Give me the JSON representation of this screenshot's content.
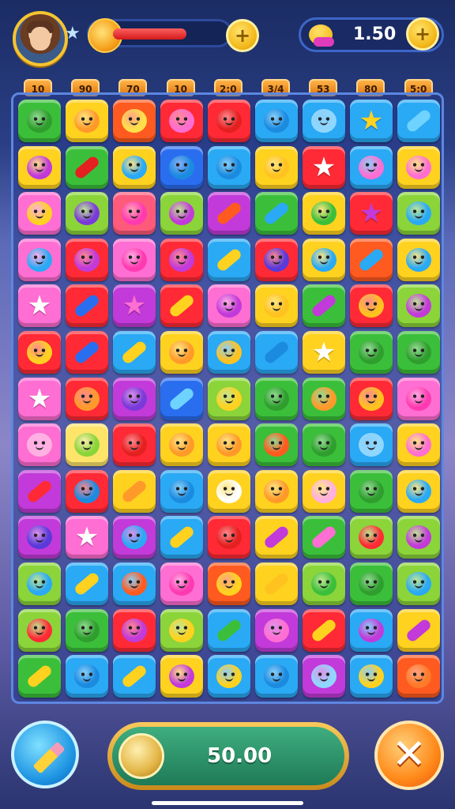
{
  "hud": {
    "energy_fill": 0.62,
    "coins_value": "1.50",
    "plus_label": "+"
  },
  "column_labels": [
    "10",
    "90",
    "70",
    "10",
    "2:0",
    "3/4",
    "53",
    "80",
    "5:0"
  ],
  "board": {
    "rows": [
      [
        [
          "#3bbf3a",
          "blob",
          "#2f9e2e"
        ],
        [
          "#ffd21f",
          "blob",
          "#ff9a2a"
        ],
        [
          "#ff5a1f",
          "blob",
          "#ffe04a"
        ],
        [
          "#ff2a35",
          "blob",
          "#ff6ed2"
        ],
        [
          "#ff2a35",
          "blob",
          "#e52020"
        ],
        [
          "#2aa9f5",
          "blob",
          "#1b8be0"
        ],
        [
          "#2aa9f5",
          "blob",
          "#8fd7ff"
        ],
        [
          "#2aa9f5",
          "star",
          "#ffd21f"
        ],
        [
          "#2aa9f5",
          "candy",
          "#6fd3ff"
        ]
      ],
      [
        [
          "#ffd21f",
          "blob",
          "#c23ad9"
        ],
        [
          "#3bbf3a",
          "candy",
          "#e52020"
        ],
        [
          "#ffd21f",
          "blob",
          "#2aa9f5"
        ],
        [
          "#2a6ef0",
          "blob",
          "#1b8be0"
        ],
        [
          "#2aa9f5",
          "blob",
          "#1b8be0"
        ],
        [
          "#ffd21f",
          "blob",
          "#ffc21f"
        ],
        [
          "#ff2a35",
          "star",
          "#ffffff"
        ],
        [
          "#2aa9f5",
          "blob",
          "#ff6ed2"
        ],
        [
          "#ffd21f",
          "blob",
          "#ff6ed2"
        ]
      ],
      [
        [
          "#ff6ed2",
          "blob",
          "#ffd21f"
        ],
        [
          "#8bd43a",
          "blob",
          "#7a3ad9"
        ],
        [
          "#ff5a7a",
          "blob",
          "#ff3ab0"
        ],
        [
          "#8bd43a",
          "blob",
          "#c23ad9"
        ],
        [
          "#c23ad9",
          "candy",
          "#ff5a1f"
        ],
        [
          "#3bbf3a",
          "candy",
          "#2aa9f5"
        ],
        [
          "#ffd21f",
          "blob",
          "#3bbf3a"
        ],
        [
          "#ff2a35",
          "star",
          "#c23ad9"
        ],
        [
          "#8bd43a",
          "blob",
          "#2aa9f5"
        ]
      ],
      [
        [
          "#ff6ed2",
          "blob",
          "#2aa9f5"
        ],
        [
          "#ff2a35",
          "blob",
          "#c23ad9"
        ],
        [
          "#ff6ed2",
          "blob",
          "#ff3ab0"
        ],
        [
          "#ff2a35",
          "blob",
          "#c23ad9"
        ],
        [
          "#2aa9f5",
          "candy",
          "#ffd21f"
        ],
        [
          "#ff2a35",
          "blob",
          "#5a3ad9"
        ],
        [
          "#ffd21f",
          "blob",
          "#2aa9f5"
        ],
        [
          "#ff5a1f",
          "candy",
          "#2aa9f5"
        ],
        [
          "#ffd21f",
          "blob",
          "#2aa9f5"
        ]
      ],
      [
        [
          "#ff6ed2",
          "star",
          "#ffffff"
        ],
        [
          "#ff2a35",
          "candy",
          "#2a6ef0"
        ],
        [
          "#c23ad9",
          "star",
          "#ff6ed2"
        ],
        [
          "#ff2a35",
          "candy",
          "#ffd21f"
        ],
        [
          "#ff6ed2",
          "blob",
          "#c23ad9"
        ],
        [
          "#ffd21f",
          "blob",
          "#ffc21f"
        ],
        [
          "#3bbf3a",
          "candy",
          "#c23ad9"
        ],
        [
          "#ff2a35",
          "blob",
          "#ffc21f"
        ],
        [
          "#8bd43a",
          "blob",
          "#c23ad9"
        ]
      ],
      [
        [
          "#ff2a35",
          "blob",
          "#ffd21f"
        ],
        [
          "#ff2a35",
          "candy",
          "#2a6ef0"
        ],
        [
          "#2aa9f5",
          "candy",
          "#ffd21f"
        ],
        [
          "#ffd21f",
          "blob",
          "#ff9a2a"
        ],
        [
          "#2aa9f5",
          "blob",
          "#ffc21f"
        ],
        [
          "#2aa9f5",
          "candy",
          "#1b8be0"
        ],
        [
          "#ffd21f",
          "star",
          "#ffffff"
        ],
        [
          "#3bbf3a",
          "blob",
          "#2f9e2e"
        ],
        [
          "#3bbf3a",
          "blob",
          "#2f9e2e"
        ]
      ],
      [
        [
          "#ff6ed2",
          "star",
          "#ffffff"
        ],
        [
          "#ff2a35",
          "blob",
          "#ff9a2a"
        ],
        [
          "#c23ad9",
          "blob",
          "#7a3ad9"
        ],
        [
          "#2a6ef0",
          "candy",
          "#6fd3ff"
        ],
        [
          "#8bd43a",
          "blob",
          "#ffd21f"
        ],
        [
          "#3bbf3a",
          "blob",
          "#2f9e2e"
        ],
        [
          "#3bbf3a",
          "blob",
          "#ff9a2a"
        ],
        [
          "#ff2a35",
          "blob",
          "#ffc21f"
        ],
        [
          "#ff6ed2",
          "blob",
          "#ff3ab0"
        ]
      ],
      [
        [
          "#ff6ed2",
          "blob",
          "#ffb0e0"
        ],
        [
          "#ffe46a",
          "blob",
          "#8bd43a"
        ],
        [
          "#ff2a35",
          "blob",
          "#e52020"
        ],
        [
          "#ffd21f",
          "blob",
          "#ff9a2a"
        ],
        [
          "#ffd21f",
          "blob",
          "#ff9a2a"
        ],
        [
          "#3bbf3a",
          "blob",
          "#ff5a1f"
        ],
        [
          "#3bbf3a",
          "blob",
          "#2f9e2e"
        ],
        [
          "#2aa9f5",
          "blob",
          "#8fd7ff"
        ],
        [
          "#ffd21f",
          "blob",
          "#ff6ed2"
        ]
      ],
      [
        [
          "#c23ad9",
          "candy",
          "#ff2a35"
        ],
        [
          "#ff2a35",
          "blob",
          "#1b8be0"
        ],
        [
          "#ffd21f",
          "candy",
          "#ff9a2a"
        ],
        [
          "#2aa9f5",
          "blob",
          "#1b8be0"
        ],
        [
          "#ffd21f",
          "blob",
          "#ffffff"
        ],
        [
          "#ffd21f",
          "blob",
          "#ff9a2a"
        ],
        [
          "#ffd21f",
          "blob",
          "#ffb0e0"
        ],
        [
          "#3bbf3a",
          "blob",
          "#2f9e2e"
        ],
        [
          "#ffd21f",
          "blob",
          "#2aa9f5"
        ]
      ],
      [
        [
          "#c23ad9",
          "blob",
          "#5a3ad9"
        ],
        [
          "#ff6ed2",
          "star",
          "#ffffff"
        ],
        [
          "#c23ad9",
          "blob",
          "#2aa9f5"
        ],
        [
          "#2aa9f5",
          "candy",
          "#ffd21f"
        ],
        [
          "#ff2a35",
          "blob",
          "#e52020"
        ],
        [
          "#ffd21f",
          "candy",
          "#c23ad9"
        ],
        [
          "#3bbf3a",
          "candy",
          "#ff6ed2"
        ],
        [
          "#8bd43a",
          "blob",
          "#ff2a35"
        ],
        [
          "#8bd43a",
          "blob",
          "#c23ad9"
        ]
      ],
      [
        [
          "#8bd43a",
          "blob",
          "#2aa9f5"
        ],
        [
          "#2aa9f5",
          "candy",
          "#ffd21f"
        ],
        [
          "#2aa9f5",
          "blob",
          "#ff5a1f"
        ],
        [
          "#ff6ed2",
          "blob",
          "#ff3ab0"
        ],
        [
          "#ff5a1f",
          "blob",
          "#ffd21f"
        ],
        [
          "#ffd21f",
          "candy",
          "#ffc21f"
        ],
        [
          "#8bd43a",
          "blob",
          "#3bbf3a"
        ],
        [
          "#3bbf3a",
          "blob",
          "#2f9e2e"
        ],
        [
          "#8bd43a",
          "blob",
          "#2aa9f5"
        ]
      ],
      [
        [
          "#8bd43a",
          "blob",
          "#ff2a35"
        ],
        [
          "#3bbf3a",
          "blob",
          "#2f9e2e"
        ],
        [
          "#ff2a35",
          "blob",
          "#c23ad9"
        ],
        [
          "#8bd43a",
          "blob",
          "#ffd21f"
        ],
        [
          "#2aa9f5",
          "candy",
          "#3bbf3a"
        ],
        [
          "#c23ad9",
          "blob",
          "#ff6ed2"
        ],
        [
          "#ff2a35",
          "candy",
          "#ffd21f"
        ],
        [
          "#2aa9f5",
          "blob",
          "#c23ad9"
        ],
        [
          "#ffd21f",
          "candy",
          "#c23ad9"
        ]
      ],
      [
        [
          "#3bbf3a",
          "candy",
          "#ffd21f"
        ],
        [
          "#2aa9f5",
          "blob",
          "#1b8be0"
        ],
        [
          "#2aa9f5",
          "candy",
          "#ffd21f"
        ],
        [
          "#ffd21f",
          "blob",
          "#c23ad9"
        ],
        [
          "#2aa9f5",
          "blob",
          "#ffd21f"
        ],
        [
          "#2aa9f5",
          "blob",
          "#1b8be0"
        ],
        [
          "#c23ad9",
          "blob",
          "#8fd7ff"
        ],
        [
          "#2aa9f5",
          "blob",
          "#ffd21f"
        ],
        [
          "#ff5a1f",
          "blob",
          "#ff7a2a"
        ]
      ]
    ]
  },
  "bottom": {
    "score_value": "50.00"
  }
}
